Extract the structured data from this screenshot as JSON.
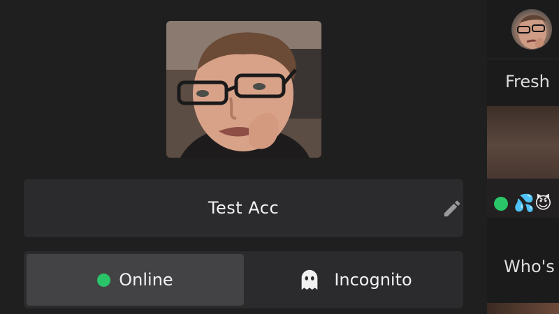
{
  "profile": {
    "display_name": "Test Acc",
    "avatar_icon": "user-photo",
    "edit_icon": "pencil-icon"
  },
  "status": {
    "online_label": "Online",
    "incognito_label": "Incognito",
    "selected": "Online",
    "online_color": "#2ac568"
  },
  "sidebar": {
    "section_fresh": "Fresh",
    "section_who": "Who's",
    "thumbnail_emojis": "💦😈"
  },
  "colors": {
    "background": "#1f1f1f",
    "card": "#2b2b2d",
    "selected_tab": "#434345",
    "text": "#f2f2f2"
  }
}
